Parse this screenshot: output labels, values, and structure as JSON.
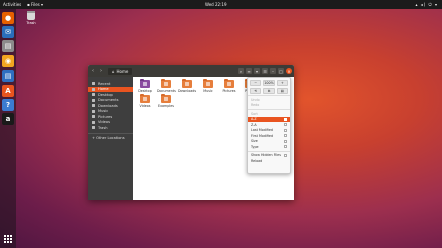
{
  "topbar": {
    "activities": "Activities",
    "app_menu": "▪ Files ▾",
    "clock": "Wed 22:19",
    "system": "▴ ◂) ⏻ ▾"
  },
  "dock": {
    "items": [
      {
        "name": "firefox",
        "color": "#e66000",
        "glyph": "●"
      },
      {
        "name": "thunderbird",
        "color": "#2a6ebb",
        "glyph": "✉"
      },
      {
        "name": "files",
        "color": "#8b8b8b",
        "glyph": "▤"
      },
      {
        "name": "rhythmbox",
        "color": "#f2a520",
        "glyph": "◉"
      },
      {
        "name": "libreoffice-writer",
        "color": "#2e6fc1",
        "glyph": "▤"
      },
      {
        "name": "software",
        "color": "#e8541e",
        "glyph": "A"
      },
      {
        "name": "help",
        "color": "#3b7bd1",
        "glyph": "?"
      },
      {
        "name": "amazon",
        "color": "#1a1a1a",
        "glyph": "a"
      }
    ]
  },
  "desktop": {
    "trash_label": "Trash"
  },
  "window": {
    "path_label": "Home",
    "sidebar": [
      {
        "label": "Recent",
        "active": false
      },
      {
        "label": "Home",
        "active": true
      },
      {
        "label": "Desktop",
        "active": false
      },
      {
        "label": "Documents",
        "active": false
      },
      {
        "label": "Downloads",
        "active": false
      },
      {
        "label": "Music",
        "active": false
      },
      {
        "label": "Pictures",
        "active": false
      },
      {
        "label": "Videos",
        "active": false
      },
      {
        "label": "Trash",
        "active": false
      },
      {
        "label": "+ Other Locations",
        "active": false
      }
    ],
    "files": [
      {
        "label": "Desktop"
      },
      {
        "label": "Documents"
      },
      {
        "label": "Downloads"
      },
      {
        "label": "Music"
      },
      {
        "label": "Pictures"
      },
      {
        "label": "Public"
      },
      {
        "label": "Templates"
      },
      {
        "label": "Videos"
      },
      {
        "label": "Examples"
      }
    ]
  },
  "popover": {
    "zoom": [
      "−",
      "100%",
      "+"
    ],
    "view_row": [
      "⟲",
      "⧉",
      "▤"
    ],
    "items": [
      {
        "label": "Undo",
        "dim": true
      },
      {
        "label": "Redo",
        "dim": true
      },
      {
        "label": "Sort",
        "dim": true
      },
      {
        "label": "A-Z",
        "selected": true
      },
      {
        "label": "Z-A",
        "selected": false
      },
      {
        "label": "Last Modified",
        "selected": false
      },
      {
        "label": "First Modified",
        "selected": false
      },
      {
        "label": "Size",
        "selected": false
      },
      {
        "label": "Type",
        "selected": false
      },
      {
        "label": "Show Hidden Files",
        "selected": false
      },
      {
        "label": "Reload",
        "selected": false
      }
    ]
  }
}
